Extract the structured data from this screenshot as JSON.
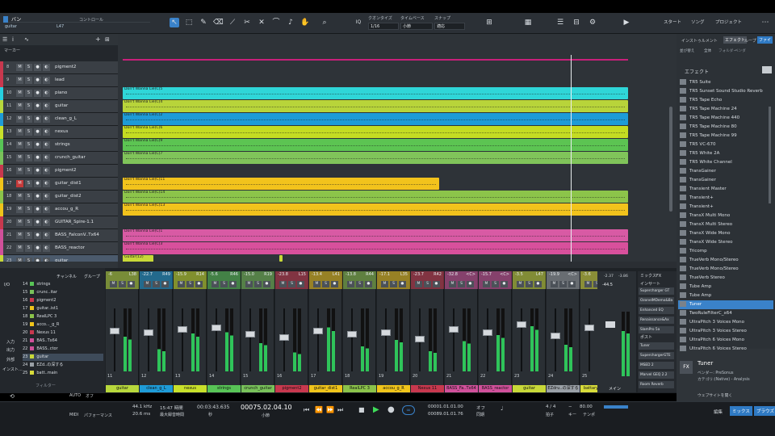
{
  "app": {
    "title_icon": "studio-one-logo-icon",
    "song_name": "バン",
    "track_label": "guitar",
    "track_num": "L47",
    "controller_label": "コントロール"
  },
  "toolbar": {
    "quantize_label": "クオンタイズ",
    "quantize_value": "1/16",
    "timebase_label": "タイムベース",
    "timebase_value": "小節",
    "snap_label": "スナップ",
    "snap_value": "適応",
    "iq": "IQ",
    "nav": [
      "スタート",
      "ソング",
      "プロジェクト"
    ]
  },
  "ruler": {
    "ticks": [
      "5",
      "9",
      "13",
      "17",
      "21",
      "25",
      "29",
      "33",
      "37",
      "41",
      "45",
      "49",
      "53",
      "57",
      "61",
      "65",
      "69",
      "73",
      "77",
      "81",
      "85"
    ],
    "start_label": "スタート",
    "end_label": "エンド",
    "marker_label": "マーカー"
  },
  "tracks": [
    {
      "num": "8",
      "name": "pigment2",
      "color": "#c8384e"
    },
    {
      "num": "9",
      "name": "lead",
      "color": "#c8384e"
    },
    {
      "num": "10",
      "name": "piano",
      "color": "#26d0e0"
    },
    {
      "num": "11",
      "name": "guitar",
      "color": "#b8d83c"
    },
    {
      "num": "12",
      "name": "clean_g_L",
      "color": "#1e9bd7"
    },
    {
      "num": "13",
      "name": "nexus",
      "color": "#c8e02a"
    },
    {
      "num": "14",
      "name": "strings",
      "color": "#58c456"
    },
    {
      "num": "15",
      "name": "crunch_guitar",
      "color": "#79c25a"
    },
    {
      "num": "16",
      "name": "pigment2",
      "color": "#c8384e"
    },
    {
      "num": "17",
      "name": "guitar_dist1",
      "color": "#f0c41a"
    },
    {
      "num": "18",
      "name": "guitar_dist2",
      "color": "#8bc34a"
    },
    {
      "num": "19",
      "name": "accou_g_R",
      "color": "#f0c41a"
    },
    {
      "num": "20",
      "name": "GUITAR_Spire-1.1",
      "color": "#c8384e"
    },
    {
      "num": "21",
      "name": "BASS_FalconV..Tx64",
      "color": "#d0509a"
    },
    {
      "num": "22",
      "name": "BASS_reactor",
      "color": "#d0509a"
    },
    {
      "num": "23",
      "name": "guitar",
      "color": "#c8d838"
    }
  ],
  "clips": [
    {
      "label": "Don't Wanna Lie(C)5",
      "color": "#2fd6d8"
    },
    {
      "label": "Don't Wanna Lie(C)4",
      "color": "#b8d43a"
    },
    {
      "label": "Don't Wanna Lie(C)2",
      "color": "#1e9bd7"
    },
    {
      "label": "Don't Wanna Lie(C)6",
      "color": "#c4dc22"
    },
    {
      "label": "Don't Wanna Lie(C)9",
      "color": "#5cc452"
    },
    {
      "label": "Don't Wanna Lie(C)7",
      "color": "#80c45a"
    },
    {
      "label": "Don't Wanna Lie(C)11",
      "color": "#f2c31c"
    },
    {
      "label": "Don't Wanna Lie(C)14",
      "color": "#8cc44a"
    },
    {
      "label": "Don't Wanna Lie(C)13",
      "color": "#f2c31c"
    },
    {
      "label": "Don't Wanna Lie(C)1",
      "color": "#d85aa4"
    },
    {
      "label": "Don't Wanna Lie(C)3",
      "color": "#d8509c"
    },
    {
      "label": "Guitar(12)",
      "color": "#c8d838"
    }
  ],
  "inspector": {
    "tabs": [
      "インストゥルメント",
      "エフェクト",
      "ループ",
      "ファイ"
    ],
    "filter": [
      "並び替え",
      "全体",
      "フォルダー",
      "ベンダ"
    ],
    "header": "エフェクト",
    "items": [
      "TR5 Suite",
      "TR5 Sunset Sound Studio Reverb",
      "TR5 Tape Echo",
      "TR5 Tape Machine 24",
      "TR5 Tape Machine 440",
      "TR5 Tape Machine 80",
      "TR5 Tape Machine 99",
      "TR5 VC-670",
      "TR5 White 2A",
      "TR5 White Channel",
      "TransGainer",
      "TransGainer",
      "Transient Master",
      "Transient+",
      "Transient+",
      "TransX Multi Mono",
      "TransX Multi Stereo",
      "TransX Wide Mono",
      "TransX Wide Stereo",
      "Tricomp",
      "TrueVerb Mono/Stereo",
      "TrueVerb Mono/Stereo",
      "TrueVerb Stereo",
      "Tube Amp",
      "Tube Amp",
      "Tuner",
      "TwoRuleFilterC_x64",
      "UltraPitch 3 Voices Mono",
      "UltraPitch 3 Voices Stereo",
      "UltraPitch 6 Voices Mono",
      "UltraPitch 6 Voices Stereo"
    ],
    "selected": "Tuner",
    "detail": {
      "badge": "FX",
      "name": "Tuner",
      "vendor": "ベンダー: PreSonus",
      "category": "カテゴリ:(Native) - Analysis",
      "website": "ウェブサイトを開く"
    },
    "bottom_tabs": [
      "編集",
      "ミックス",
      "ブラウズ"
    ]
  },
  "mixer": {
    "left_header": [
      "チャンネル",
      "グループ"
    ],
    "left_items": [
      {
        "n": "14",
        "name": "strings",
        "color": "#58c456"
      },
      {
        "n": "15",
        "name": "crunc..itar",
        "color": "#79c25a"
      },
      {
        "n": "16",
        "name": "pigment2",
        "color": "#c8384e"
      },
      {
        "n": "17",
        "name": "guitar..ist1",
        "color": "#f0c41a"
      },
      {
        "n": "18",
        "name": "RealLPC 3",
        "color": "#8bc34a"
      },
      {
        "n": "19",
        "name": "acco..._g_R",
        "color": "#f0c41a"
      },
      {
        "n": "20",
        "name": "Nexus 11",
        "color": "#c8384e"
      },
      {
        "n": "21",
        "name": "BAS..Tx64",
        "color": "#d0509a"
      },
      {
        "n": "22",
        "name": "BASS..ctor",
        "color": "#d0509a"
      },
      {
        "n": "23",
        "name": "guitar",
        "color": "#c8d838"
      },
      {
        "n": "24",
        "name": "EZd..の深する",
        "color": "#9aa0a6"
      },
      {
        "n": "25",
        "name": "batt..main",
        "color": "#d8dc3a"
      }
    ],
    "left_labels": [
      "I/O",
      "入力",
      "出力",
      "外部",
      "インスト..."
    ],
    "left_footer": "フィルター",
    "strips": [
      {
        "pan_l": "-6",
        "pan_r": "L38",
        "num": "11",
        "name": "guitar",
        "color": "#b8d83c"
      },
      {
        "pan_l": "-22.7",
        "pan_r": "R49",
        "num": "12",
        "name": "clean_g_L",
        "color": "#1e9bd7"
      },
      {
        "pan_l": "-15.9",
        "pan_r": "R14",
        "num": "13",
        "name": "nexus",
        "color": "#c8e02a"
      },
      {
        "pan_l": "-5.6",
        "pan_r": "R46",
        "num": "14",
        "name": "strings",
        "color": "#58c456"
      },
      {
        "pan_l": "-15.0",
        "pan_r": "R19",
        "num": "15",
        "name": "crunch_guitar",
        "color": "#79c25a"
      },
      {
        "pan_l": "-23.8",
        "pan_r": "L15",
        "num": "16",
        "name": "pigment2",
        "color": "#c8384e"
      },
      {
        "pan_l": "-13.4",
        "pan_r": "L41",
        "num": "17",
        "name": "guitar_dist1",
        "color": "#f0c41a"
      },
      {
        "pan_l": "-13.8",
        "pan_r": "R44",
        "num": "18",
        "name": "RealLPC 3",
        "color": "#8bc34a"
      },
      {
        "pan_l": "-17.1",
        "pan_r": "L35",
        "num": "19",
        "name": "accou_g_R",
        "color": "#f0c41a"
      },
      {
        "pan_l": "-23.7",
        "pan_r": "R42",
        "num": "20",
        "name": "Nexus 11",
        "color": "#c8384e"
      },
      {
        "pan_l": "-32.8",
        "pan_r": "<C>",
        "num": "21",
        "name": "BASS_Fa..Tx64",
        "color": "#d0509a"
      },
      {
        "pan_l": "-15.7",
        "pan_r": "<C>",
        "num": "22",
        "name": "BASS_reactor",
        "color": "#d0509a"
      },
      {
        "pan_l": "-3.5",
        "pan_r": "L47",
        "num": "23",
        "name": "guitar",
        "color": "#c8d838"
      },
      {
        "pan_l": "-19.9",
        "pan_r": "<C>",
        "num": "24",
        "name": "EZdru..の深する",
        "color": "#9aa0a6"
      },
      {
        "pan_l": "-3.6",
        "pan_r": "<C>",
        "num": "25",
        "name": "battary_main",
        "color": "#d8dc3a"
      }
    ],
    "main": {
      "label": "メイン",
      "db1": "-2.37",
      "db2": "-3.86",
      "db3": "-44.5"
    },
    "sends_header": "ミックスFX",
    "sends_insert": "インサート",
    "sends_post": "ポスト",
    "sends": [
      "Supercharger GT",
      "OzoneIMDemo&Ba",
      "Enhanced EQ",
      "Renaissance&Ax",
      "SlamPro 5a",
      "Tuner",
      "SuperchargerGTE",
      "MSED 2",
      "Marvel GEQ 2.2",
      "Room Reverb"
    ]
  },
  "transport": {
    "sample_rate": "44.1 kHz",
    "latency": "20.6 ms",
    "record_time": "15:47 時間",
    "record_label": "最大録音時間",
    "time": "00:03:43.635",
    "time_unit": "秒",
    "bars": "00075.02.04.10",
    "bars_unit": "小節",
    "loop_l": "00001.01.01.00",
    "loop_r": "00089.01.01.76",
    "metronome": "オフ",
    "sync": "同期",
    "timesig": "4 / 4",
    "timesig_label": "拍子",
    "key": "−",
    "key_label": "キー",
    "tempo": "80.00",
    "tempo_label": "テンポ",
    "midi": "MIDI",
    "performance": "パフォーマンス",
    "autolabel": "AUTO",
    "off": "オフ"
  }
}
